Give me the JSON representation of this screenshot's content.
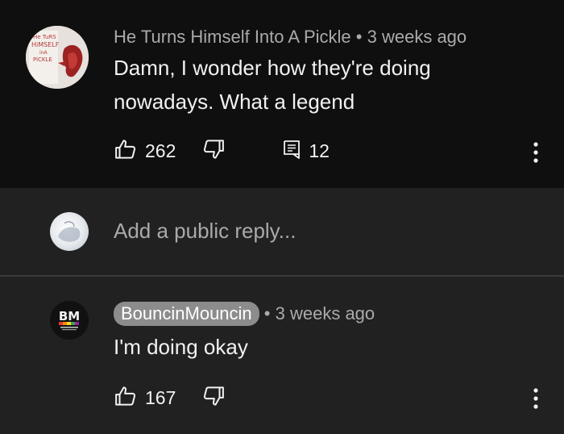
{
  "top_comment": {
    "author": "He Turns Himself Into A Pickle",
    "separator": "•",
    "time": "3 weeks ago",
    "text_line1": "Damn, I wonder how they're doing",
    "text_line2": "nowadays. What a legend",
    "likes": "262",
    "replies": "12",
    "avatar_icon": "pickle-avatar",
    "avatar_lettering": "He Turns Himself Into A Pickle"
  },
  "reply_box": {
    "placeholder": "Add a public reply..."
  },
  "reply_comment": {
    "author": "BouncinMouncin",
    "separator": "•",
    "time": "3 weeks ago",
    "text": "I'm doing okay",
    "likes": "167",
    "avatar_logo_text": "BM"
  },
  "icons": {
    "like": "thumbs-up-icon",
    "dislike": "thumbs-down-icon",
    "reply": "comment-reply-icon",
    "more": "more-vertical-icon"
  },
  "colors": {
    "background_dark": "#0f0f0f",
    "background": "#212121",
    "secondary_text": "#aaaaaa",
    "author_chip": "#8c8c8c"
  }
}
